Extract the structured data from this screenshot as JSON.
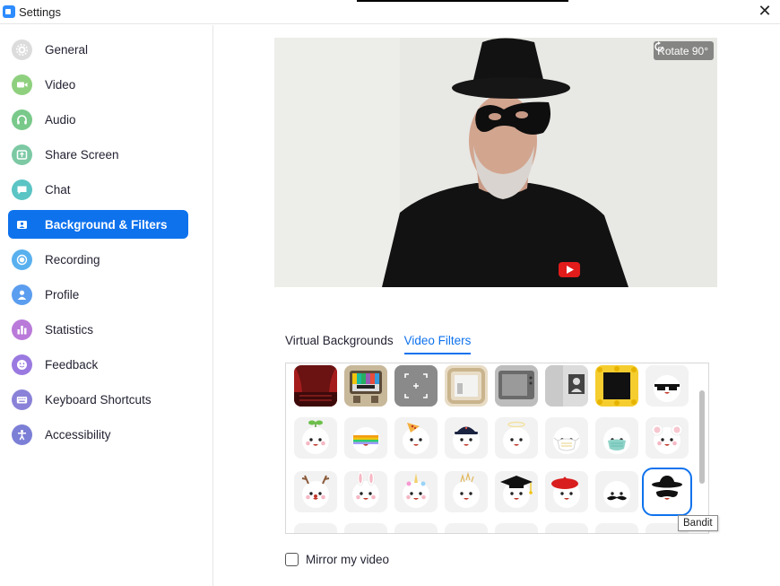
{
  "window": {
    "title": "Settings"
  },
  "colors": {
    "accent": "#0e72ed"
  },
  "sidebar": {
    "items": [
      {
        "label": "General",
        "icon": "gear-icon",
        "color": "#dcdcdc",
        "active": false
      },
      {
        "label": "Video",
        "icon": "video-camera-icon",
        "color": "#8fd07f",
        "active": false
      },
      {
        "label": "Audio",
        "icon": "headphones-icon",
        "color": "#79c98a",
        "active": false
      },
      {
        "label": "Share Screen",
        "icon": "share-screen-icon",
        "color": "#7cc9a4",
        "active": false
      },
      {
        "label": "Chat",
        "icon": "chat-bubble-icon",
        "color": "#5bc4c4",
        "active": false
      },
      {
        "label": "Background & Filters",
        "icon": "background-icon",
        "color": "#0e72ed",
        "active": true
      },
      {
        "label": "Recording",
        "icon": "record-icon",
        "color": "#59b0ee",
        "active": false
      },
      {
        "label": "Profile",
        "icon": "profile-icon",
        "color": "#5b9def",
        "active": false
      },
      {
        "label": "Statistics",
        "icon": "statistics-icon",
        "color": "#b97ad9",
        "active": false
      },
      {
        "label": "Feedback",
        "icon": "feedback-icon",
        "color": "#9a7ae0",
        "active": false
      },
      {
        "label": "Keyboard Shortcuts",
        "icon": "keyboard-icon",
        "color": "#8a82d8",
        "active": false
      },
      {
        "label": "Accessibility",
        "icon": "accessibility-icon",
        "color": "#7c7fd6",
        "active": false
      }
    ]
  },
  "preview": {
    "rotate_label": "Rotate 90°"
  },
  "tabs": [
    {
      "label": "Virtual Backgrounds",
      "active": false
    },
    {
      "label": "Video Filters",
      "active": true
    }
  ],
  "filters": {
    "row1": [
      "theater",
      "retro-tv-test",
      "viewfinder",
      "frame-room",
      "tv-frame",
      "room-frame",
      "emoji-frame",
      "pixel-sunglasses"
    ],
    "row2": [
      "sprout",
      "rainbow",
      "pizza",
      "cap",
      "halo",
      "mask-white",
      "mask-blue",
      "mouse-ears"
    ],
    "row3": [
      "reindeer",
      "bunny",
      "unicorn",
      "sparkle-crown",
      "graduation-cap",
      "beret",
      "mustache",
      "bandit"
    ],
    "selected": "bandit"
  },
  "tooltip": {
    "text": "Bandit"
  },
  "mirror": {
    "label": "Mirror my video",
    "checked": false
  }
}
